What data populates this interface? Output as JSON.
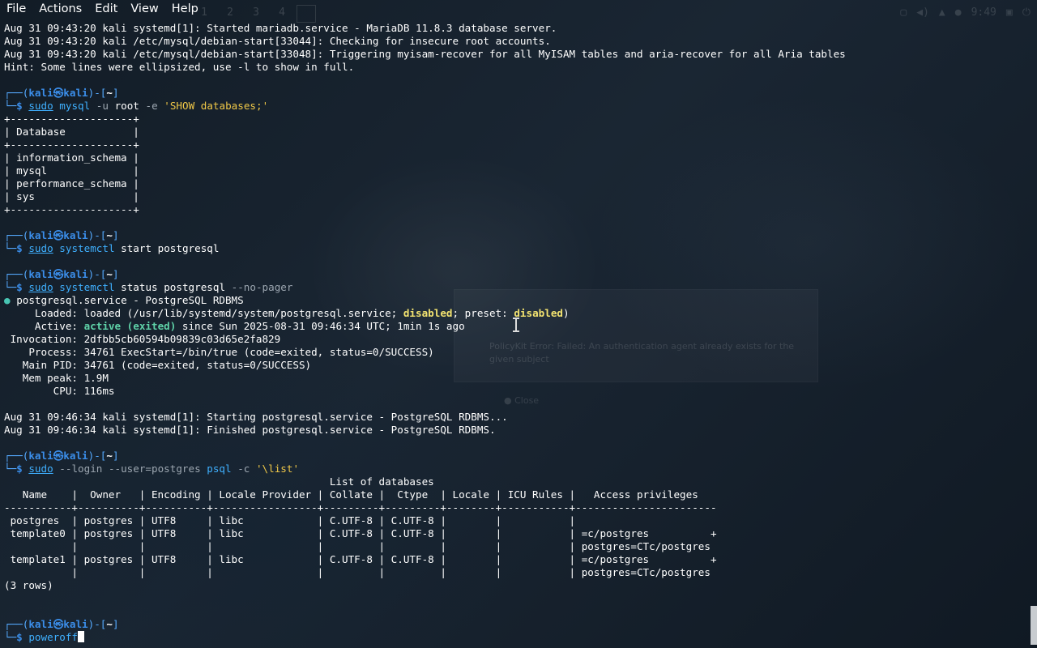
{
  "menu": [
    "File",
    "Actions",
    "Edit",
    "View",
    "Help"
  ],
  "ghost": {
    "workspaces": [
      "1",
      "2",
      "3",
      "4"
    ],
    "clock": "9:49",
    "dialog_text": "PolicyKit Error: Failed: An authentication agent already exists for the given subject",
    "dialog_close": "Close"
  },
  "prompt": {
    "user": "kali",
    "host": "kali",
    "path": "~"
  },
  "lines": {
    "l1": "Aug 31 09:43:20 kali systemd[1]: Started mariadb.service - MariaDB 11.8.3 database server.",
    "l2": "Aug 31 09:43:20 kali /etc/mysql/debian-start[33044]: Checking for insecure root accounts.",
    "l3": "Aug 31 09:43:20 kali /etc/mysql/debian-start[33048]: Triggering myisam-recover for all MyISAM tables and aria-recover for all Aria tables",
    "l4": "Hint: Some lines were ellipsized, use -l to show in full.",
    "cmd1": {
      "sudo": "sudo",
      "bin": "mysql",
      "opt": "-u",
      "arg": "root",
      "opt2": "-e",
      "str": "'SHOW databases;'"
    },
    "mysql_border": "+--------------------+",
    "mysql_header": "| Database           |",
    "mysql_rows": [
      "| information_schema |",
      "| mysql              |",
      "| performance_schema |",
      "| sys                |"
    ],
    "cmd2": {
      "sudo": "sudo",
      "bin": "systemctl",
      "args": "start postgresql"
    },
    "cmd3": {
      "sudo": "sudo",
      "bin": "systemctl",
      "args": "status postgresql",
      "opt": "--no-pager"
    },
    "svc": "postgresql.service - PostgreSQL RDBMS",
    "loaded_pre": "     Loaded: loaded (/usr/lib/systemd/system/postgresql.service; ",
    "loaded_mid": "; preset: ",
    "disabled": "disabled",
    "loaded_post": ")",
    "active_pre": "     Active: ",
    "active_word": "active (exited)",
    "active_post": " since Sun 2025-08-31 09:46:34 UTC; 1min 1s ago",
    "invocation": " Invocation: 2dfbb5cb60594b09839c03d65e2fa829",
    "process": "    Process: 34761 ExecStart=/bin/true (code=exited, status=0/SUCCESS)",
    "mainpid": "   Main PID: 34761 (code=exited, status=0/SUCCESS)",
    "mempeak": "   Mem peak: 1.9M",
    "cpu": "        CPU: 116ms",
    "log1": "Aug 31 09:46:34 kali systemd[1]: Starting postgresql.service - PostgreSQL RDBMS...",
    "log2": "Aug 31 09:46:34 kali systemd[1]: Finished postgresql.service - PostgreSQL RDBMS.",
    "cmd4": {
      "sudo": "sudo",
      "opt": "--login --user=postgres",
      "bin": "psql",
      "opt2": "-c",
      "str": "'\\list'"
    },
    "psql_title": "                                                     List of databases",
    "psql_header": "   Name    |  Owner   | Encoding | Locale Provider | Collate |  Ctype  | Locale | ICU Rules |   Access privileges",
    "psql_sep": "-----------+----------+----------+-----------------+---------+---------+--------+-----------+-----------------------",
    "psql_rows": [
      " postgres  | postgres | UTF8     | libc            | C.UTF-8 | C.UTF-8 |        |           |",
      " template0 | postgres | UTF8     | libc            | C.UTF-8 | C.UTF-8 |        |           | =c/postgres          +",
      "           |          |          |                 |         |         |        |           | postgres=CTc/postgres",
      " template1 | postgres | UTF8     | libc            | C.UTF-8 | C.UTF-8 |        |           | =c/postgres          +",
      "           |          |          |                 |         |         |        |           | postgres=CTc/postgres"
    ],
    "rowcount": "(3 rows)",
    "cmd5": "poweroff"
  }
}
